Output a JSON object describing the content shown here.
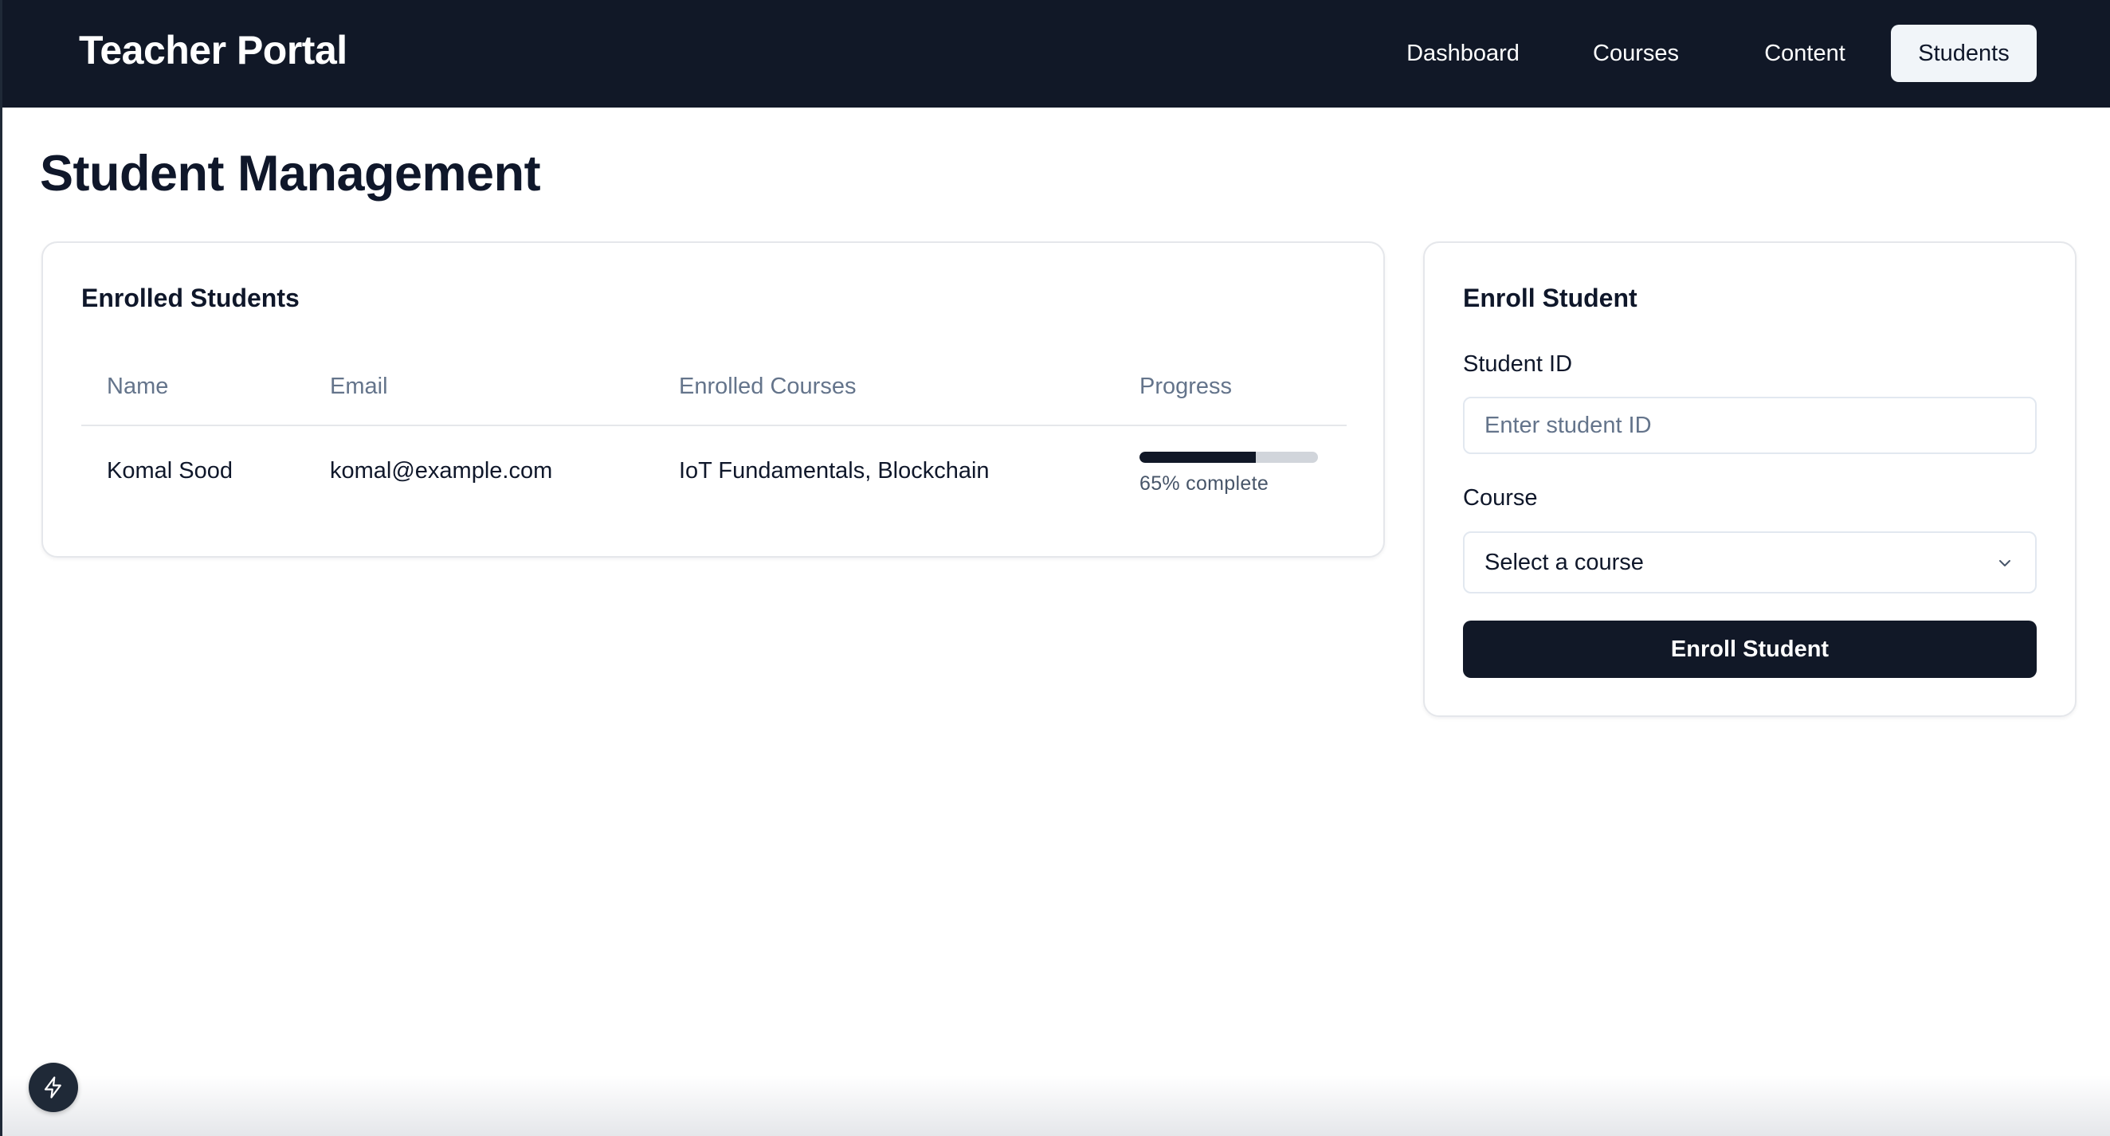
{
  "header": {
    "brand": "Teacher Portal",
    "nav": [
      {
        "label": "Dashboard",
        "active": false
      },
      {
        "label": "Courses",
        "active": false
      },
      {
        "label": "Content",
        "active": false
      },
      {
        "label": "Students",
        "active": true
      }
    ]
  },
  "page": {
    "title": "Student Management"
  },
  "enrolled": {
    "title": "Enrolled Students",
    "columns": [
      "Name",
      "Email",
      "Enrolled Courses",
      "Progress"
    ],
    "rows": [
      {
        "name": "Komal Sood",
        "email": "komal@example.com",
        "courses": "IoT Fundamentals, Blockchain",
        "progress_value": 0.65,
        "progress_text": "65% complete"
      }
    ]
  },
  "enroll_form": {
    "title": "Enroll Student",
    "student_id_label": "Student ID",
    "student_id_placeholder": "Enter student ID",
    "student_id_value": "",
    "course_label": "Course",
    "course_selected": "Select a course",
    "submit_label": "Enroll Student"
  },
  "icons": {
    "select_chevron": "chevron-down-icon",
    "fab": "lightning-icon"
  },
  "colors": {
    "header_bg": "#111827",
    "accent": "#111827",
    "muted_text": "#64748b"
  }
}
